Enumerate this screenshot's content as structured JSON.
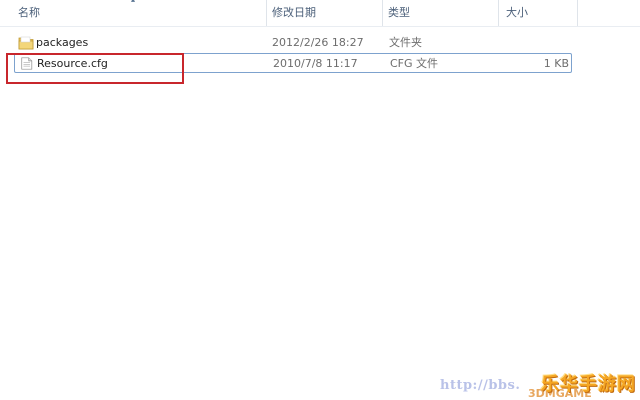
{
  "columns": {
    "name": "名称",
    "date": "修改日期",
    "type": "类型",
    "size": "大小"
  },
  "files": [
    {
      "icon": "folder-icon",
      "name": "packages",
      "date": "2012/2/26 18:27",
      "type": "文件夹",
      "size": ""
    },
    {
      "icon": "cfg-file-icon",
      "name": "Resource.cfg",
      "date": "2010/7/8 11:17",
      "type": "CFG 文件",
      "size": "1 KB"
    }
  ],
  "highlight_color": "#c8262c",
  "selection_color": "#7da2ce",
  "watermark": {
    "url": "http://bbs.",
    "brand": "乐华手游网",
    "game": "3DMGAME"
  }
}
